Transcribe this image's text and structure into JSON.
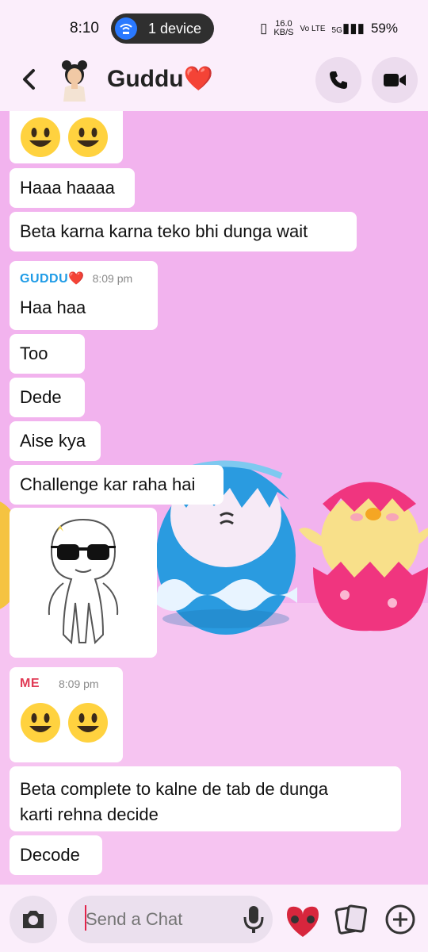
{
  "status_bar": {
    "time": "8:10",
    "pill_label": "1 device",
    "net_speed_top": "16.0",
    "net_speed_unit": "KB/S",
    "vo_lte": "Vo LTE",
    "signal": "5G",
    "battery": "59%"
  },
  "header": {
    "contact_name": "Guddu",
    "heart": "❤️"
  },
  "messages": {
    "m1": "Haaa haaaa",
    "m2": "Beta karna karna teko bhi dunga wait",
    "guddu_label": "GUDDU",
    "guddu_heart": "❤️",
    "guddu_time": "8:09 pm",
    "m3": "Haa haa",
    "m4": "Too",
    "m5": "Dede",
    "m6": "Aise kya",
    "m7": "Challenge kar raha hai",
    "me_label": "ME",
    "me_time": "8:09 pm",
    "m8_line1": "Beta complete to kalne de tab de dunga",
    "m8_line2": "karti rehna decide",
    "m9": "Decode"
  },
  "composer": {
    "placeholder": "Send a Chat"
  },
  "colors": {
    "guddu": "#1e9be6",
    "me": "#e03a55",
    "background": "#f2b3ee"
  },
  "icons": [
    "back-arrow-icon",
    "phone-icon",
    "video-icon",
    "camera-icon",
    "mic-icon",
    "bitmoji-icon",
    "cards-icon",
    "plus-icon"
  ]
}
